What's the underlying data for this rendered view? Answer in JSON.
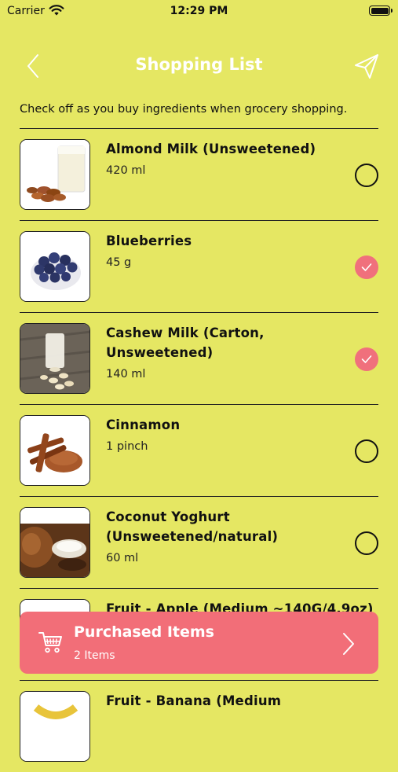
{
  "status_bar": {
    "carrier": "Carrier",
    "time": "12:29 PM"
  },
  "header": {
    "title": "Shopping List"
  },
  "instruction": "Check off as you buy ingredients when grocery shopping.",
  "items": [
    {
      "name": "Almond Milk (Unsweetened)",
      "quantity": "420 ml",
      "checked": false,
      "image": "almond-milk-image"
    },
    {
      "name": "Blueberries",
      "quantity": "45 g",
      "checked": true,
      "image": "blueberries-image"
    },
    {
      "name": "Cashew Milk (Carton, Unsweetened)",
      "quantity": "140 ml",
      "checked": true,
      "image": "cashew-milk-image"
    },
    {
      "name": "Cinnamon",
      "quantity": "1 pinch",
      "checked": false,
      "image": "cinnamon-image"
    },
    {
      "name": "Coconut Yoghurt (Unsweetened/natural)",
      "quantity": "60 ml",
      "checked": false,
      "image": "coconut-yoghurt-image"
    },
    {
      "name": "Fruit - Apple (Medium ~140G/4.9oz)",
      "quantity": "",
      "checked": false,
      "image": "apple-image"
    },
    {
      "name": "Fruit - Banana (Medium",
      "quantity": "",
      "checked": false,
      "image": "banana-image"
    }
  ],
  "purchased": {
    "title": "Purchased Items",
    "count_label": "2 Items"
  },
  "colors": {
    "background": "#e5e763",
    "accent": "#f26e78",
    "check_on": "#f0707c"
  }
}
